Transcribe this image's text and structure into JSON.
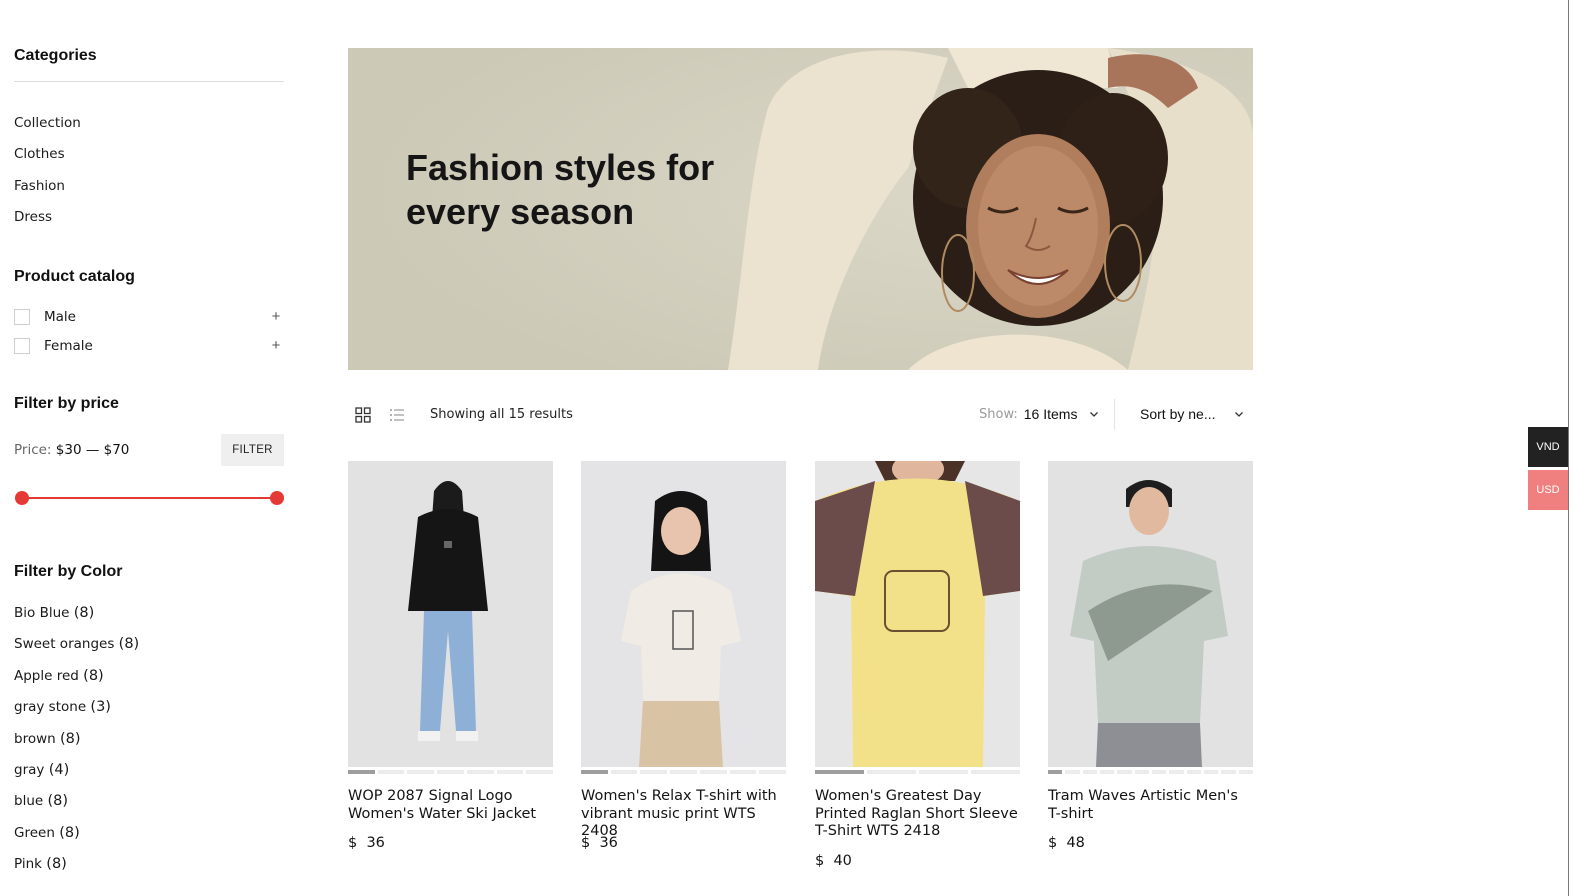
{
  "sidebar": {
    "categories_heading": "Categories",
    "categories": [
      "Collection",
      "Clothes",
      "Fashion",
      "Dress"
    ],
    "catalog_heading": "Product catalog",
    "catalog": [
      {
        "label": "Male",
        "expand": "+"
      },
      {
        "label": "Female",
        "expand": "+"
      }
    ],
    "price_heading": "Filter by price",
    "price_label": "Price:",
    "price_range": "$30 — $70",
    "price_min": 30,
    "price_max": 70,
    "filter_button": "FILTER",
    "color_heading": "Filter by Color",
    "colors": [
      {
        "name": "Bio Blue",
        "count": "(8)"
      },
      {
        "name": "Sweet oranges",
        "count": "(8)"
      },
      {
        "name": "Apple red",
        "count": "(8)"
      },
      {
        "name": "gray stone",
        "count": "(3)"
      },
      {
        "name": "brown",
        "count": "(8)"
      },
      {
        "name": "gray",
        "count": "(4)"
      },
      {
        "name": "blue",
        "count": "(8)"
      },
      {
        "name": "Green",
        "count": "(8)"
      },
      {
        "name": "Pink",
        "count": "(8)"
      }
    ]
  },
  "hero": {
    "title": "Fashion styles for every season"
  },
  "toolbar": {
    "grid_icon": "grid-view-icon",
    "list_icon": "list-view-icon",
    "results": "Showing all 15 results",
    "show_label": "Show:",
    "show_value": "16 Items",
    "sort_value": "Sort by ne..."
  },
  "products": [
    {
      "title": "WOP 2087 Signal Logo Women's Water Ski Jacket",
      "currency": "$",
      "price": "36",
      "image_count": 7,
      "active_image": 0
    },
    {
      "title": "Women's Relax T-shirt with vibrant music print WTS 2408",
      "currency": "$",
      "price": "36",
      "image_count": 7,
      "active_image": 0
    },
    {
      "title": "Women's Greatest Day Printed Raglan Short Sleeve T-Shirt WTS 2418",
      "currency": "$",
      "price": "40",
      "image_count": 4,
      "active_image": 0
    },
    {
      "title": "Tram Waves Artistic Men's T-shirt",
      "currency": "$",
      "price": "48",
      "image_count": 12,
      "active_image": 0
    }
  ],
  "currency": {
    "options": [
      "VND",
      "USD"
    ],
    "active": "USD"
  },
  "colors": {
    "accent_red": "#e53935",
    "usd_pink": "#f08080",
    "vnd_dark": "#222222"
  }
}
